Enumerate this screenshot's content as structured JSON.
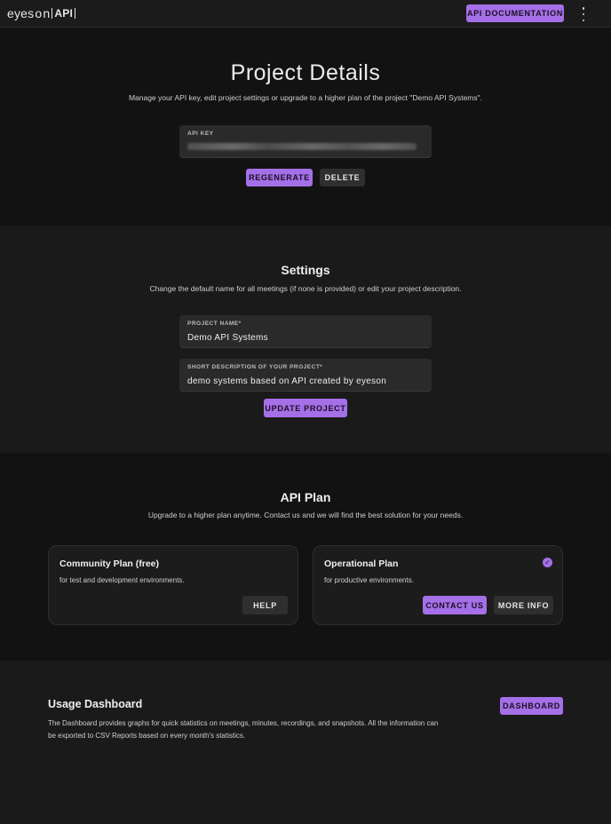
{
  "header": {
    "logo_text": "eyes",
    "logo_o": "o",
    "logo_n": "n",
    "logo_api": "API",
    "api_doc_label": "API DOCUMENTATION"
  },
  "project_details": {
    "title": "Project Details",
    "subtitle": "Manage your API key, edit project settings or upgrade to a higher plan of the project \"Demo API Systems\".",
    "api_key_label": "API KEY",
    "regenerate_label": "REGENERATE",
    "delete_label": "DELETE"
  },
  "settings": {
    "title": "Settings",
    "subtitle": "Change the default name for all meetings (if none is provided) or edit your project description.",
    "project_name_label": "PROJECT NAME*",
    "project_name_value": "Demo API Systems",
    "description_label": "SHORT DESCRIPTION OF YOUR PROJECT*",
    "description_value": "demo systems based on API created by eyeson",
    "update_label": "UPDATE PROJECT"
  },
  "api_plan": {
    "title": "API Plan",
    "subtitle": "Upgrade to a higher plan anytime. Contact us and we will find the best solution for your needs.",
    "plans": [
      {
        "title": "Community Plan (free)",
        "desc": "for test and development environments.",
        "help_label": "HELP"
      },
      {
        "title": "Operational Plan",
        "desc": "for productive environments.",
        "contact_label": "CONTACT US",
        "more_label": "MORE INFO",
        "selected": true
      }
    ],
    "check_glyph": "✓",
    "accent_color": "#a56fe8"
  },
  "usage": {
    "title": "Usage Dashboard",
    "desc": "The Dashboard provides graphs for quick statistics on meetings, minutes, recordings, and snapshots. All the information can be exported to CSV Reports based on every month's statistics.",
    "dashboard_label": "DASHBOARD"
  }
}
